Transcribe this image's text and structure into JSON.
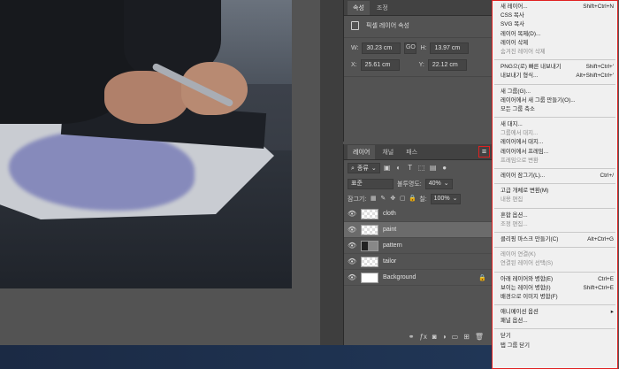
{
  "properties": {
    "tabs": [
      "속성",
      "조정"
    ],
    "title": "픽셀 레이어 속성",
    "w_label": "W:",
    "w_value": "30.23 cm",
    "link_label": "GO",
    "h_label": "H:",
    "h_value": "13.97 cm",
    "x_label": "X:",
    "x_value": "25.61 cm",
    "y_label": "Y:",
    "y_value": "22.12 cm"
  },
  "layers": {
    "tabs": [
      "레이어",
      "채널",
      "패스"
    ],
    "menu_glyph": "≡",
    "filter_value": "종류",
    "blend_value": "표준",
    "opacity_label": "불투명도:",
    "opacity_value": "40%",
    "lock_label": "잠그기:",
    "fill_label": "칠:",
    "fill_value": "100%",
    "items": [
      {
        "name": "cloth"
      },
      {
        "name": "paint"
      },
      {
        "name": "pattern"
      },
      {
        "name": "tailor"
      },
      {
        "name": "Background"
      }
    ]
  },
  "menu": {
    "items": [
      {
        "label": "새 레이어...",
        "shortcut": "Shift+Ctrl+N"
      },
      {
        "label": "CSS 복사",
        "shortcut": ""
      },
      {
        "label": "SVG 복사",
        "shortcut": ""
      },
      {
        "label": "레이어 복제(D)...",
        "shortcut": ""
      },
      {
        "label": "레이어 삭제",
        "shortcut": ""
      },
      {
        "label": "숨겨진 레이어 삭제",
        "shortcut": ""
      },
      {
        "label": "PNG으(로) 빠른 내보내기",
        "shortcut": "Shift+Ctrl+'"
      },
      {
        "label": "내보내기 형식...",
        "shortcut": "Alt+Shift+Ctrl+'"
      },
      {
        "label": "새 그룹(G)...",
        "shortcut": ""
      },
      {
        "label": "레이어에서 새 그룹 만들기(O)...",
        "shortcut": ""
      },
      {
        "label": "모든 그룹 축소",
        "shortcut": ""
      },
      {
        "label": "새 대지...",
        "shortcut": ""
      },
      {
        "label": "그룹에서 대지...",
        "shortcut": ""
      },
      {
        "label": "레이어에서 대지...",
        "shortcut": ""
      },
      {
        "label": "레이어에서 프레임...",
        "shortcut": ""
      },
      {
        "label": "프레임으로 변환",
        "shortcut": ""
      },
      {
        "label": "레이어 잠그기(L)...",
        "shortcut": "Ctrl+/"
      },
      {
        "label": "고급 개체로 변환(M)",
        "shortcut": ""
      },
      {
        "label": "내용 편집",
        "shortcut": ""
      },
      {
        "label": "혼합 옵션...",
        "shortcut": ""
      },
      {
        "label": "조정 편집...",
        "shortcut": ""
      },
      {
        "label": "클리핑 마스크 만들기(C)",
        "shortcut": "Alt+Ctrl+G"
      },
      {
        "label": "레이어 연결(K)",
        "shortcut": ""
      },
      {
        "label": "연결된 레이어 선택(S)",
        "shortcut": ""
      },
      {
        "label": "아래 레이어와 병합(E)",
        "shortcut": "Ctrl+E"
      },
      {
        "label": "보이는 레이어 병합(I)",
        "shortcut": "Shift+Ctrl+E"
      },
      {
        "label": "배경으로 이미지 병합(F)",
        "shortcut": ""
      },
      {
        "label": "애니메이션 옵션",
        "shortcut": "▸"
      },
      {
        "label": "패널 옵션...",
        "shortcut": ""
      },
      {
        "label": "닫기",
        "shortcut": ""
      },
      {
        "label": "탭 그룹 닫기",
        "shortcut": ""
      }
    ]
  }
}
